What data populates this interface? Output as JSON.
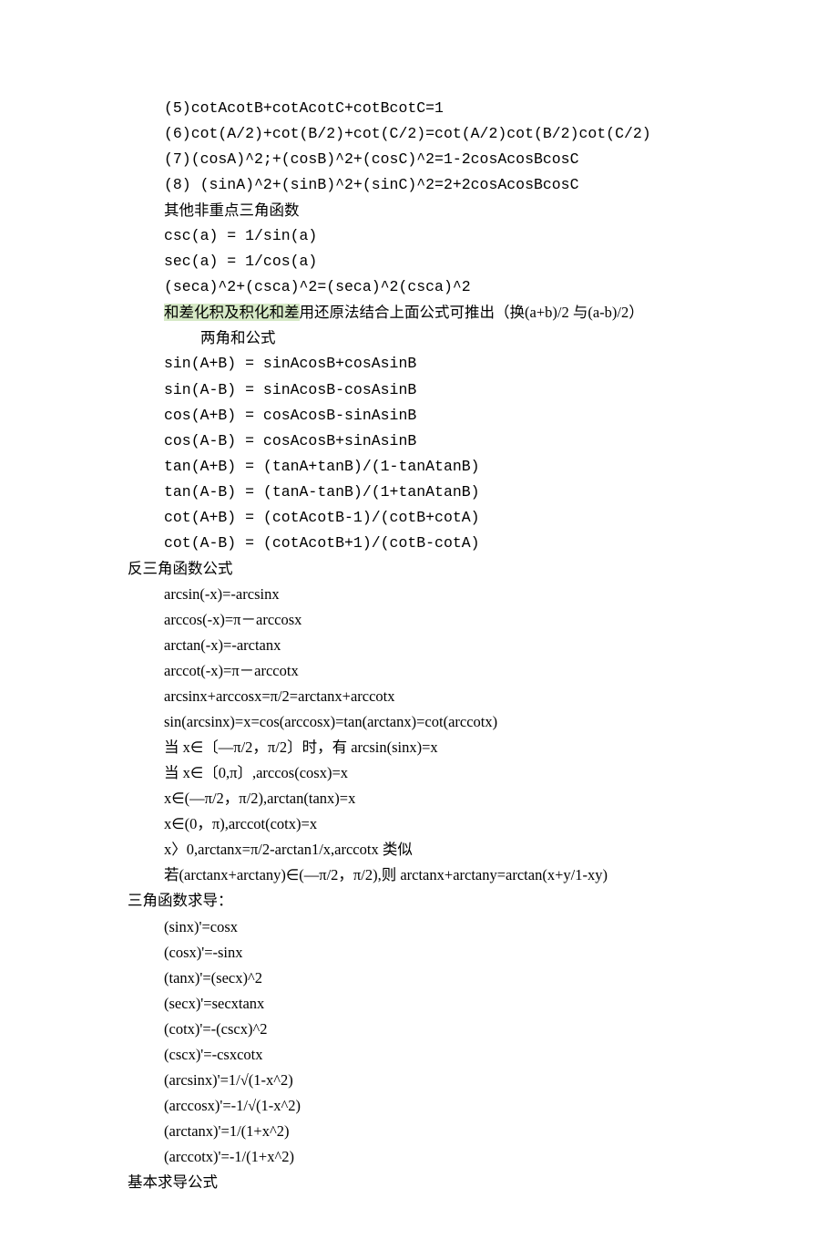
{
  "block1": [
    "(5)cotAcotB+cotAcotC+cotBcotC=1",
    "(6)cot(A/2)+cot(B/2)+cot(C/2)=cot(A/2)cot(B/2)cot(C/2)",
    "(7)(cosA)^2;+(cosB)^2+(cosC)^2=1-2cosAcosBcosC",
    "(8) (sinA)^2+(sinB)^2+(sinC)^2=2+2cosAcosBcosC",
    "其他非重点三角函数",
    "csc(a) = 1/sin(a)",
    "sec(a) = 1/cos(a)",
    "(seca)^2+(csca)^2=(seca)^2(csca)^2"
  ],
  "hl_line": {
    "highlight": "和差化积及积化和差",
    "rest": "用还原法结合上面公式可推出（换(a+b)/2 与(a-b)/2）"
  },
  "sum_heading": "两角和公式",
  "sum_block": [
    "sin(A+B) = sinAcosB+cosAsinB",
    "sin(A-B) = sinAcosB-cosAsinB",
    "cos(A+B) = cosAcosB-sinAsinB",
    "cos(A-B) = cosAcosB+sinAsinB",
    "tan(A+B) = (tanA+tanB)/(1-tanAtanB)",
    "tan(A-B) = (tanA-tanB)/(1+tanAtanB)",
    "cot(A+B) = (cotAcotB-1)/(cotB+cotA)",
    "cot(A-B) = (cotAcotB+1)/(cotB-cotA)"
  ],
  "inverse_heading": "反三角函数公式",
  "inverse_block": [
    "arcsin(-x)=-arcsinx",
    "arccos(-x)=π－arccosx",
    "arctan(-x)=-arctanx",
    "arccot(-x)=π－arccotx",
    "arcsinx+arccosx=π/2=arctanx+arccotx",
    "sin(arcsinx)=x=cos(arccosx)=tan(arctanx)=cot(arccotx)",
    "当 x∈〔—π/2，π/2〕时，有 arcsin(sinx)=x",
    "当 x∈〔0,π〕,arccos(cosx)=x",
    "x∈(—π/2，π/2),arctan(tanx)=x",
    "x∈(0，π),arccot(cotx)=x",
    "x〉0,arctanx=π/2-arctan1/x,arccotx 类似",
    "若(arctanx+arctany)∈(—π/2，π/2),则 arctanx+arctany=arctan(x+y/1-xy)"
  ],
  "deriv_heading": "三角函数求导：",
  "deriv_block": [
    "(sinx)'=cosx",
    "(cosx)'=-sinx",
    "(tanx)'=(secx)^2",
    "(secx)'=secxtanx",
    "(cotx)'=-(cscx)^2",
    "(cscx)'=-csxcotx",
    "(arcsinx)'=1/√(1-x^2)",
    "(arccosx)'=-1/√(1-x^2)",
    "(arctanx)'=1/(1+x^2)",
    "(arccotx)'=-1/(1+x^2)"
  ],
  "basic_deriv_heading": "基本求导公式"
}
